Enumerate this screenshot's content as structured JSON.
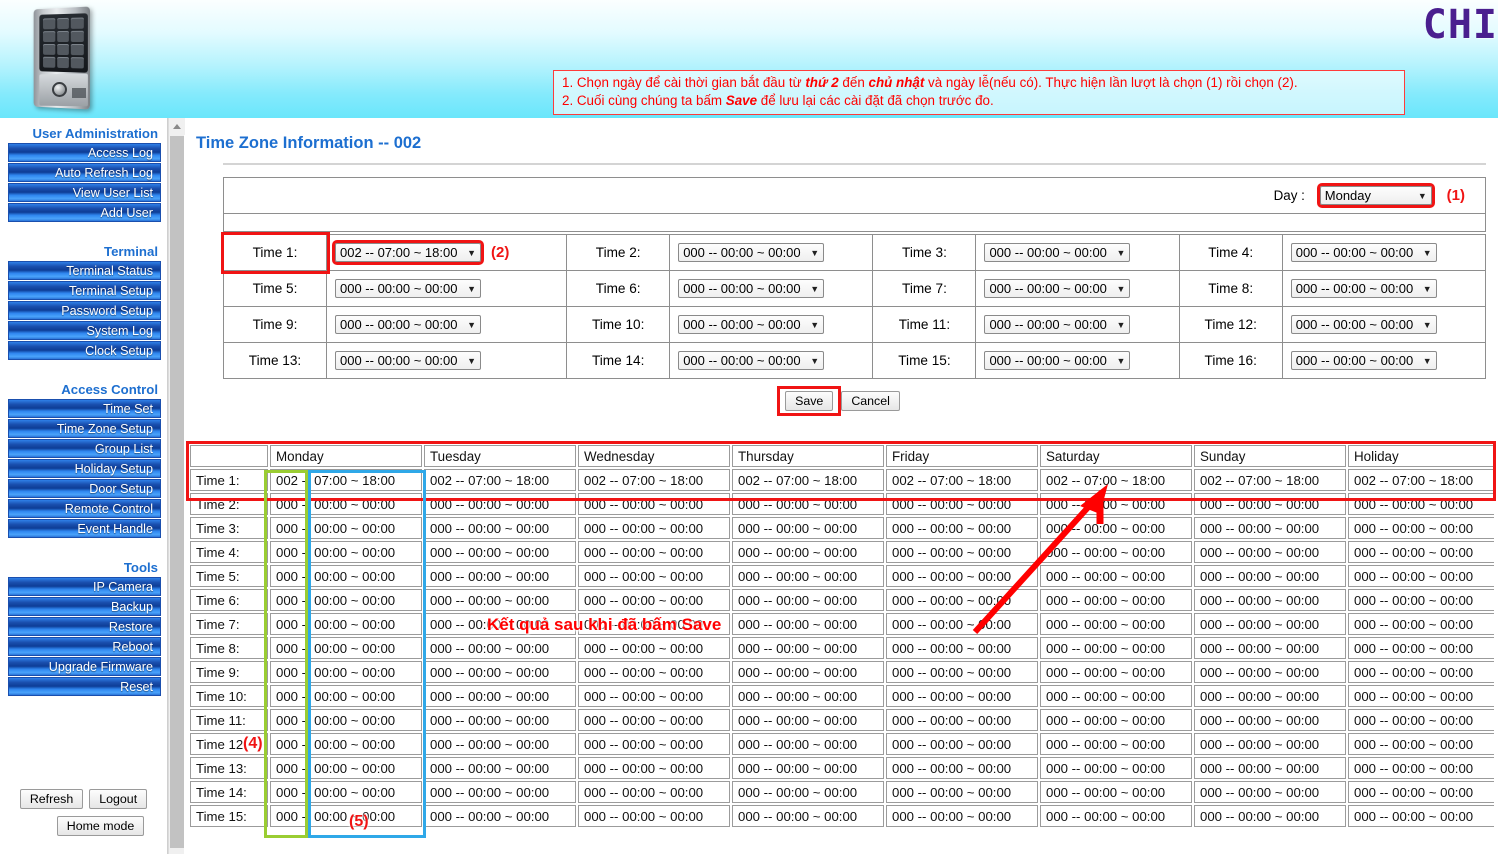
{
  "header": {
    "logo": "CHI",
    "device_icon": "keypad-access-control-device",
    "instructions": {
      "line1_a": "1. Chọn ngày để cài thời gian bắt đầu từ ",
      "line1_b": "thứ 2",
      "line1_c": " đến ",
      "line1_d": "chủ nhật",
      "line1_e": " và ngày lễ(nếu có). Thực hiện lần lượt là chọn (1) rồi chọn (2).",
      "line2_a": "2. Cuối cùng chúng ta bấm ",
      "line2_b": "Save",
      "line2_c": " để lưu lại các cài đặt đã chọn trước đo."
    }
  },
  "sidebar": {
    "groups": [
      {
        "title": "User Administration",
        "items": [
          "Access Log",
          "Auto Refresh Log",
          "View User List",
          "Add User"
        ]
      },
      {
        "title": "Terminal",
        "items": [
          "Terminal Status",
          "Terminal Setup",
          "Password Setup",
          "System Log",
          "Clock Setup"
        ]
      },
      {
        "title": "Access Control",
        "items": [
          "Time Set",
          "Time Zone Setup",
          "Group List",
          "Holiday Setup",
          "Door Setup",
          "Remote Control",
          "Event Handle"
        ]
      },
      {
        "title": "Tools",
        "items": [
          "IP Camera",
          "Backup",
          "Restore",
          "Reboot",
          "Upgrade Firmware",
          "Reset"
        ]
      }
    ],
    "footer": {
      "refresh": "Refresh",
      "logout": "Logout",
      "home_mode": "Home mode"
    }
  },
  "main": {
    "page_title": "Time Zone Information -- 002",
    "day_label": "Day :",
    "day_value": "Monday",
    "marker_1": "(1)",
    "marker_2": "(2)",
    "marker_4": "(4)",
    "marker_5": "(5)",
    "time_slots": [
      {
        "label": "Time 1:",
        "value": "002 -- 07:00 ~ 18:00",
        "highlight": true
      },
      {
        "label": "Time 2:",
        "value": "000 -- 00:00 ~ 00:00",
        "highlight": false
      },
      {
        "label": "Time 3:",
        "value": "000 -- 00:00 ~ 00:00",
        "highlight": false
      },
      {
        "label": "Time 4:",
        "value": "000 -- 00:00 ~ 00:00",
        "highlight": false
      },
      {
        "label": "Time 5:",
        "value": "000 -- 00:00 ~ 00:00",
        "highlight": false
      },
      {
        "label": "Time 6:",
        "value": "000 -- 00:00 ~ 00:00",
        "highlight": false
      },
      {
        "label": "Time 7:",
        "value": "000 -- 00:00 ~ 00:00",
        "highlight": false
      },
      {
        "label": "Time 8:",
        "value": "000 -- 00:00 ~ 00:00",
        "highlight": false
      },
      {
        "label": "Time 9:",
        "value": "000 -- 00:00 ~ 00:00",
        "highlight": false
      },
      {
        "label": "Time 10:",
        "value": "000 -- 00:00 ~ 00:00",
        "highlight": false
      },
      {
        "label": "Time 11:",
        "value": "000 -- 00:00 ~ 00:00",
        "highlight": false
      },
      {
        "label": "Time 12:",
        "value": "000 -- 00:00 ~ 00:00",
        "highlight": false
      },
      {
        "label": "Time 13:",
        "value": "000 -- 00:00 ~ 00:00",
        "highlight": false
      },
      {
        "label": "Time 14:",
        "value": "000 -- 00:00 ~ 00:00",
        "highlight": false
      },
      {
        "label": "Time 15:",
        "value": "000 -- 00:00 ~ 00:00",
        "highlight": false
      },
      {
        "label": "Time 16:",
        "value": "000 -- 00:00 ~ 00:00",
        "highlight": false
      }
    ],
    "save_label": "Save",
    "cancel_label": "Cancel"
  },
  "result_table": {
    "columns": [
      "",
      "Monday",
      "Tuesday",
      "Wednesday",
      "Thursday",
      "Friday",
      "Saturday",
      "Sunday",
      "Holiday"
    ],
    "rows": [
      {
        "label": "Time 1:",
        "values": [
          "002 -- 07:00 ~ 18:00",
          "002 -- 07:00 ~ 18:00",
          "002 -- 07:00 ~ 18:00",
          "002 -- 07:00 ~ 18:00",
          "002 -- 07:00 ~ 18:00",
          "002 -- 07:00 ~ 18:00",
          "002 -- 07:00 ~ 18:00",
          "002 -- 07:00 ~ 18:00"
        ]
      },
      {
        "label": "Time 2:",
        "values": [
          "000 -- 00:00 ~ 00:00",
          "000 -- 00:00 ~ 00:00",
          "000 -- 00:00 ~ 00:00",
          "000 -- 00:00 ~ 00:00",
          "000 -- 00:00 ~ 00:00",
          "000 -- 00:00 ~ 00:00",
          "000 -- 00:00 ~ 00:00",
          "000 -- 00:00 ~ 00:00"
        ]
      },
      {
        "label": "Time 3:",
        "values": [
          "000 -- 00:00 ~ 00:00",
          "000 -- 00:00 ~ 00:00",
          "000 -- 00:00 ~ 00:00",
          "000 -- 00:00 ~ 00:00",
          "000 -- 00:00 ~ 00:00",
          "000 -- 00:00 ~ 00:00",
          "000 -- 00:00 ~ 00:00",
          "000 -- 00:00 ~ 00:00"
        ]
      },
      {
        "label": "Time 4:",
        "values": [
          "000 -- 00:00 ~ 00:00",
          "000 -- 00:00 ~ 00:00",
          "000 -- 00:00 ~ 00:00",
          "000 -- 00:00 ~ 00:00",
          "000 -- 00:00 ~ 00:00",
          "000 -- 00:00 ~ 00:00",
          "000 -- 00:00 ~ 00:00",
          "000 -- 00:00 ~ 00:00"
        ]
      },
      {
        "label": "Time 5:",
        "values": [
          "000 -- 00:00 ~ 00:00",
          "000 -- 00:00 ~ 00:00",
          "000 -- 00:00 ~ 00:00",
          "000 -- 00:00 ~ 00:00",
          "000 -- 00:00 ~ 00:00",
          "000 -- 00:00 ~ 00:00",
          "000 -- 00:00 ~ 00:00",
          "000 -- 00:00 ~ 00:00"
        ]
      },
      {
        "label": "Time 6:",
        "values": [
          "000 -- 00:00 ~ 00:00",
          "000 -- 00:00 ~ 00:00",
          "000 -- 00:00 ~ 00:00",
          "000 -- 00:00 ~ 00:00",
          "000 -- 00:00 ~ 00:00",
          "000 -- 00:00 ~ 00:00",
          "000 -- 00:00 ~ 00:00",
          "000 -- 00:00 ~ 00:00"
        ]
      },
      {
        "label": "Time 7:",
        "values": [
          "000 -- 00:00 ~ 00:00",
          "000 -- 00:00 ~ 00:00",
          "000 -- 00:00 ~ 00:00",
          "000 -- 00:00 ~ 00:00",
          "000 -- 00:00 ~ 00:00",
          "000 -- 00:00 ~ 00:00",
          "000 -- 00:00 ~ 00:00",
          "000 -- 00:00 ~ 00:00"
        ]
      },
      {
        "label": "Time 8:",
        "values": [
          "000 -- 00:00 ~ 00:00",
          "000 -- 00:00 ~ 00:00",
          "000 -- 00:00 ~ 00:00",
          "000 -- 00:00 ~ 00:00",
          "000 -- 00:00 ~ 00:00",
          "000 -- 00:00 ~ 00:00",
          "000 -- 00:00 ~ 00:00",
          "000 -- 00:00 ~ 00:00"
        ]
      },
      {
        "label": "Time 9:",
        "values": [
          "000 -- 00:00 ~ 00:00",
          "000 -- 00:00 ~ 00:00",
          "000 -- 00:00 ~ 00:00",
          "000 -- 00:00 ~ 00:00",
          "000 -- 00:00 ~ 00:00",
          "000 -- 00:00 ~ 00:00",
          "000 -- 00:00 ~ 00:00",
          "000 -- 00:00 ~ 00:00"
        ]
      },
      {
        "label": "Time 10:",
        "values": [
          "000 -- 00:00 ~ 00:00",
          "000 -- 00:00 ~ 00:00",
          "000 -- 00:00 ~ 00:00",
          "000 -- 00:00 ~ 00:00",
          "000 -- 00:00 ~ 00:00",
          "000 -- 00:00 ~ 00:00",
          "000 -- 00:00 ~ 00:00",
          "000 -- 00:00 ~ 00:00"
        ]
      },
      {
        "label": "Time 11:",
        "values": [
          "000 -- 00:00 ~ 00:00",
          "000 -- 00:00 ~ 00:00",
          "000 -- 00:00 ~ 00:00",
          "000 -- 00:00 ~ 00:00",
          "000 -- 00:00 ~ 00:00",
          "000 -- 00:00 ~ 00:00",
          "000 -- 00:00 ~ 00:00",
          "000 -- 00:00 ~ 00:00"
        ]
      },
      {
        "label": "Time 12:",
        "values": [
          "000 -- 00:00 ~ 00:00",
          "000 -- 00:00 ~ 00:00",
          "000 -- 00:00 ~ 00:00",
          "000 -- 00:00 ~ 00:00",
          "000 -- 00:00 ~ 00:00",
          "000 -- 00:00 ~ 00:00",
          "000 -- 00:00 ~ 00:00",
          "000 -- 00:00 ~ 00:00"
        ]
      },
      {
        "label": "Time 13:",
        "values": [
          "000 -- 00:00 ~ 00:00",
          "000 -- 00:00 ~ 00:00",
          "000 -- 00:00 ~ 00:00",
          "000 -- 00:00 ~ 00:00",
          "000 -- 00:00 ~ 00:00",
          "000 -- 00:00 ~ 00:00",
          "000 -- 00:00 ~ 00:00",
          "000 -- 00:00 ~ 00:00"
        ]
      },
      {
        "label": "Time 14:",
        "values": [
          "000 -- 00:00 ~ 00:00",
          "000 -- 00:00 ~ 00:00",
          "000 -- 00:00 ~ 00:00",
          "000 -- 00:00 ~ 00:00",
          "000 -- 00:00 ~ 00:00",
          "000 -- 00:00 ~ 00:00",
          "000 -- 00:00 ~ 00:00",
          "000 -- 00:00 ~ 00:00"
        ]
      },
      {
        "label": "Time 15:",
        "values": [
          "000 -- 00:00 ~ 00:00",
          "000 -- 00:00 ~ 00:00",
          "000 -- 00:00 ~ 00:00",
          "000 -- 00:00 ~ 00:00",
          "000 -- 00:00 ~ 00:00",
          "000 -- 00:00 ~ 00:00",
          "000 -- 00:00 ~ 00:00",
          "000 -- 00:00 ~ 00:00"
        ]
      }
    ]
  },
  "annotations": {
    "result_note_a": "Kết quả sau khi đã bấm ",
    "result_note_b": "Save"
  },
  "colors": {
    "accent_blue": "#1d6fd0",
    "annotation_red": "#ff0000",
    "box_green": "#9acd32",
    "box_blue": "#2fa8e8",
    "header_cyan": "#6ae6fb",
    "logo_purple": "#4a1f8f"
  }
}
